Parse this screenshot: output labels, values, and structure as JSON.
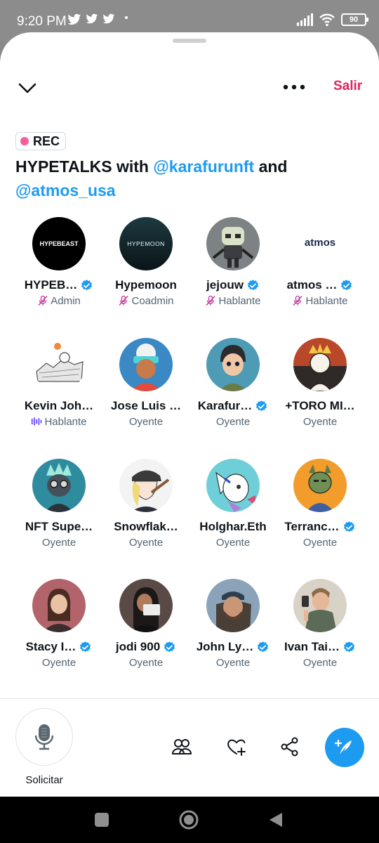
{
  "status_bar": {
    "time": "9:20 PM",
    "battery": "90"
  },
  "header": {
    "exit_label": "Salir"
  },
  "space": {
    "rec_label": "REC",
    "title_prefix": "HYPETALKS with ",
    "host1": "@karafurunft",
    "title_and": " and",
    "host2": "@atmos_usa"
  },
  "participants": [
    {
      "name": "HYPEB…",
      "role": "Admin",
      "verified": true,
      "role_icon": "mic-off-icon",
      "avatar_text": "HYPEBEAST"
    },
    {
      "name": "Hypemoon",
      "role": "Coadmin",
      "verified": false,
      "role_icon": "mic-off-icon",
      "avatar_text": "HYPEMOON"
    },
    {
      "name": "jejouw",
      "role": "Hablante",
      "verified": true,
      "role_icon": "mic-off-icon"
    },
    {
      "name": "atmos …",
      "role": "Hablante",
      "verified": true,
      "role_icon": "mic-off-icon",
      "avatar_text": "atmos"
    },
    {
      "name": "Kevin Joh…",
      "role": "Hablante",
      "verified": false,
      "role_icon": "speaking-icon"
    },
    {
      "name": "Jose Luis …",
      "role": "Oyente",
      "verified": false
    },
    {
      "name": "Karafur…",
      "role": "Oyente",
      "verified": true
    },
    {
      "name": "+TORO MI…",
      "role": "Oyente",
      "verified": false
    },
    {
      "name": "NFT Supe…",
      "role": "Oyente",
      "verified": false
    },
    {
      "name": "Snowflak…",
      "role": "Oyente",
      "verified": false
    },
    {
      "name": "Holghar.Eth",
      "role": "Oyente",
      "verified": false
    },
    {
      "name": "Terranc…",
      "role": "Oyente",
      "verified": true
    },
    {
      "name": "Stacy I…",
      "role": "Oyente",
      "verified": true
    },
    {
      "name": "jodi 900",
      "role": "Oyente",
      "verified": true
    },
    {
      "name": "John Ly…",
      "role": "Oyente",
      "verified": true
    },
    {
      "name": "Ivan Tai…",
      "role": "Oyente",
      "verified": true
    }
  ],
  "bottom_bar": {
    "request_label": "Solicitar"
  },
  "colors": {
    "accent": "#1d9bf0",
    "exit": "#e0245e",
    "rec_dot": "#f0609a",
    "mute_icon": "#c2349a",
    "speaking": "#7856ff"
  }
}
